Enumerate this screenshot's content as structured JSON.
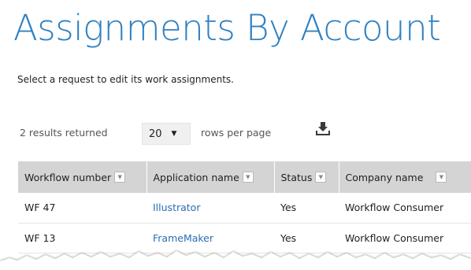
{
  "page": {
    "title": "Assignments By Account",
    "instructions": "Select a request to edit its work assignments."
  },
  "toolbar": {
    "results_count": "2 results returned",
    "rows_per_page_value": "20",
    "rows_per_page_label": "rows per page",
    "download_icon": "download-icon"
  },
  "table": {
    "columns": [
      {
        "label": "Workflow number"
      },
      {
        "label": "Application name"
      },
      {
        "label": "Status"
      },
      {
        "label": "Company name"
      }
    ],
    "rows": [
      {
        "workflow": "WF 47",
        "application": "Illustrator",
        "status": "Yes",
        "company": "Workflow Consumer"
      },
      {
        "workflow": "WF 13",
        "application": "FrameMaker",
        "status": "Yes",
        "company": "Workflow Consumer"
      }
    ]
  },
  "colors": {
    "title": "#2f80c0",
    "link": "#2a6db3",
    "header_bg": "#d4d4d4"
  }
}
